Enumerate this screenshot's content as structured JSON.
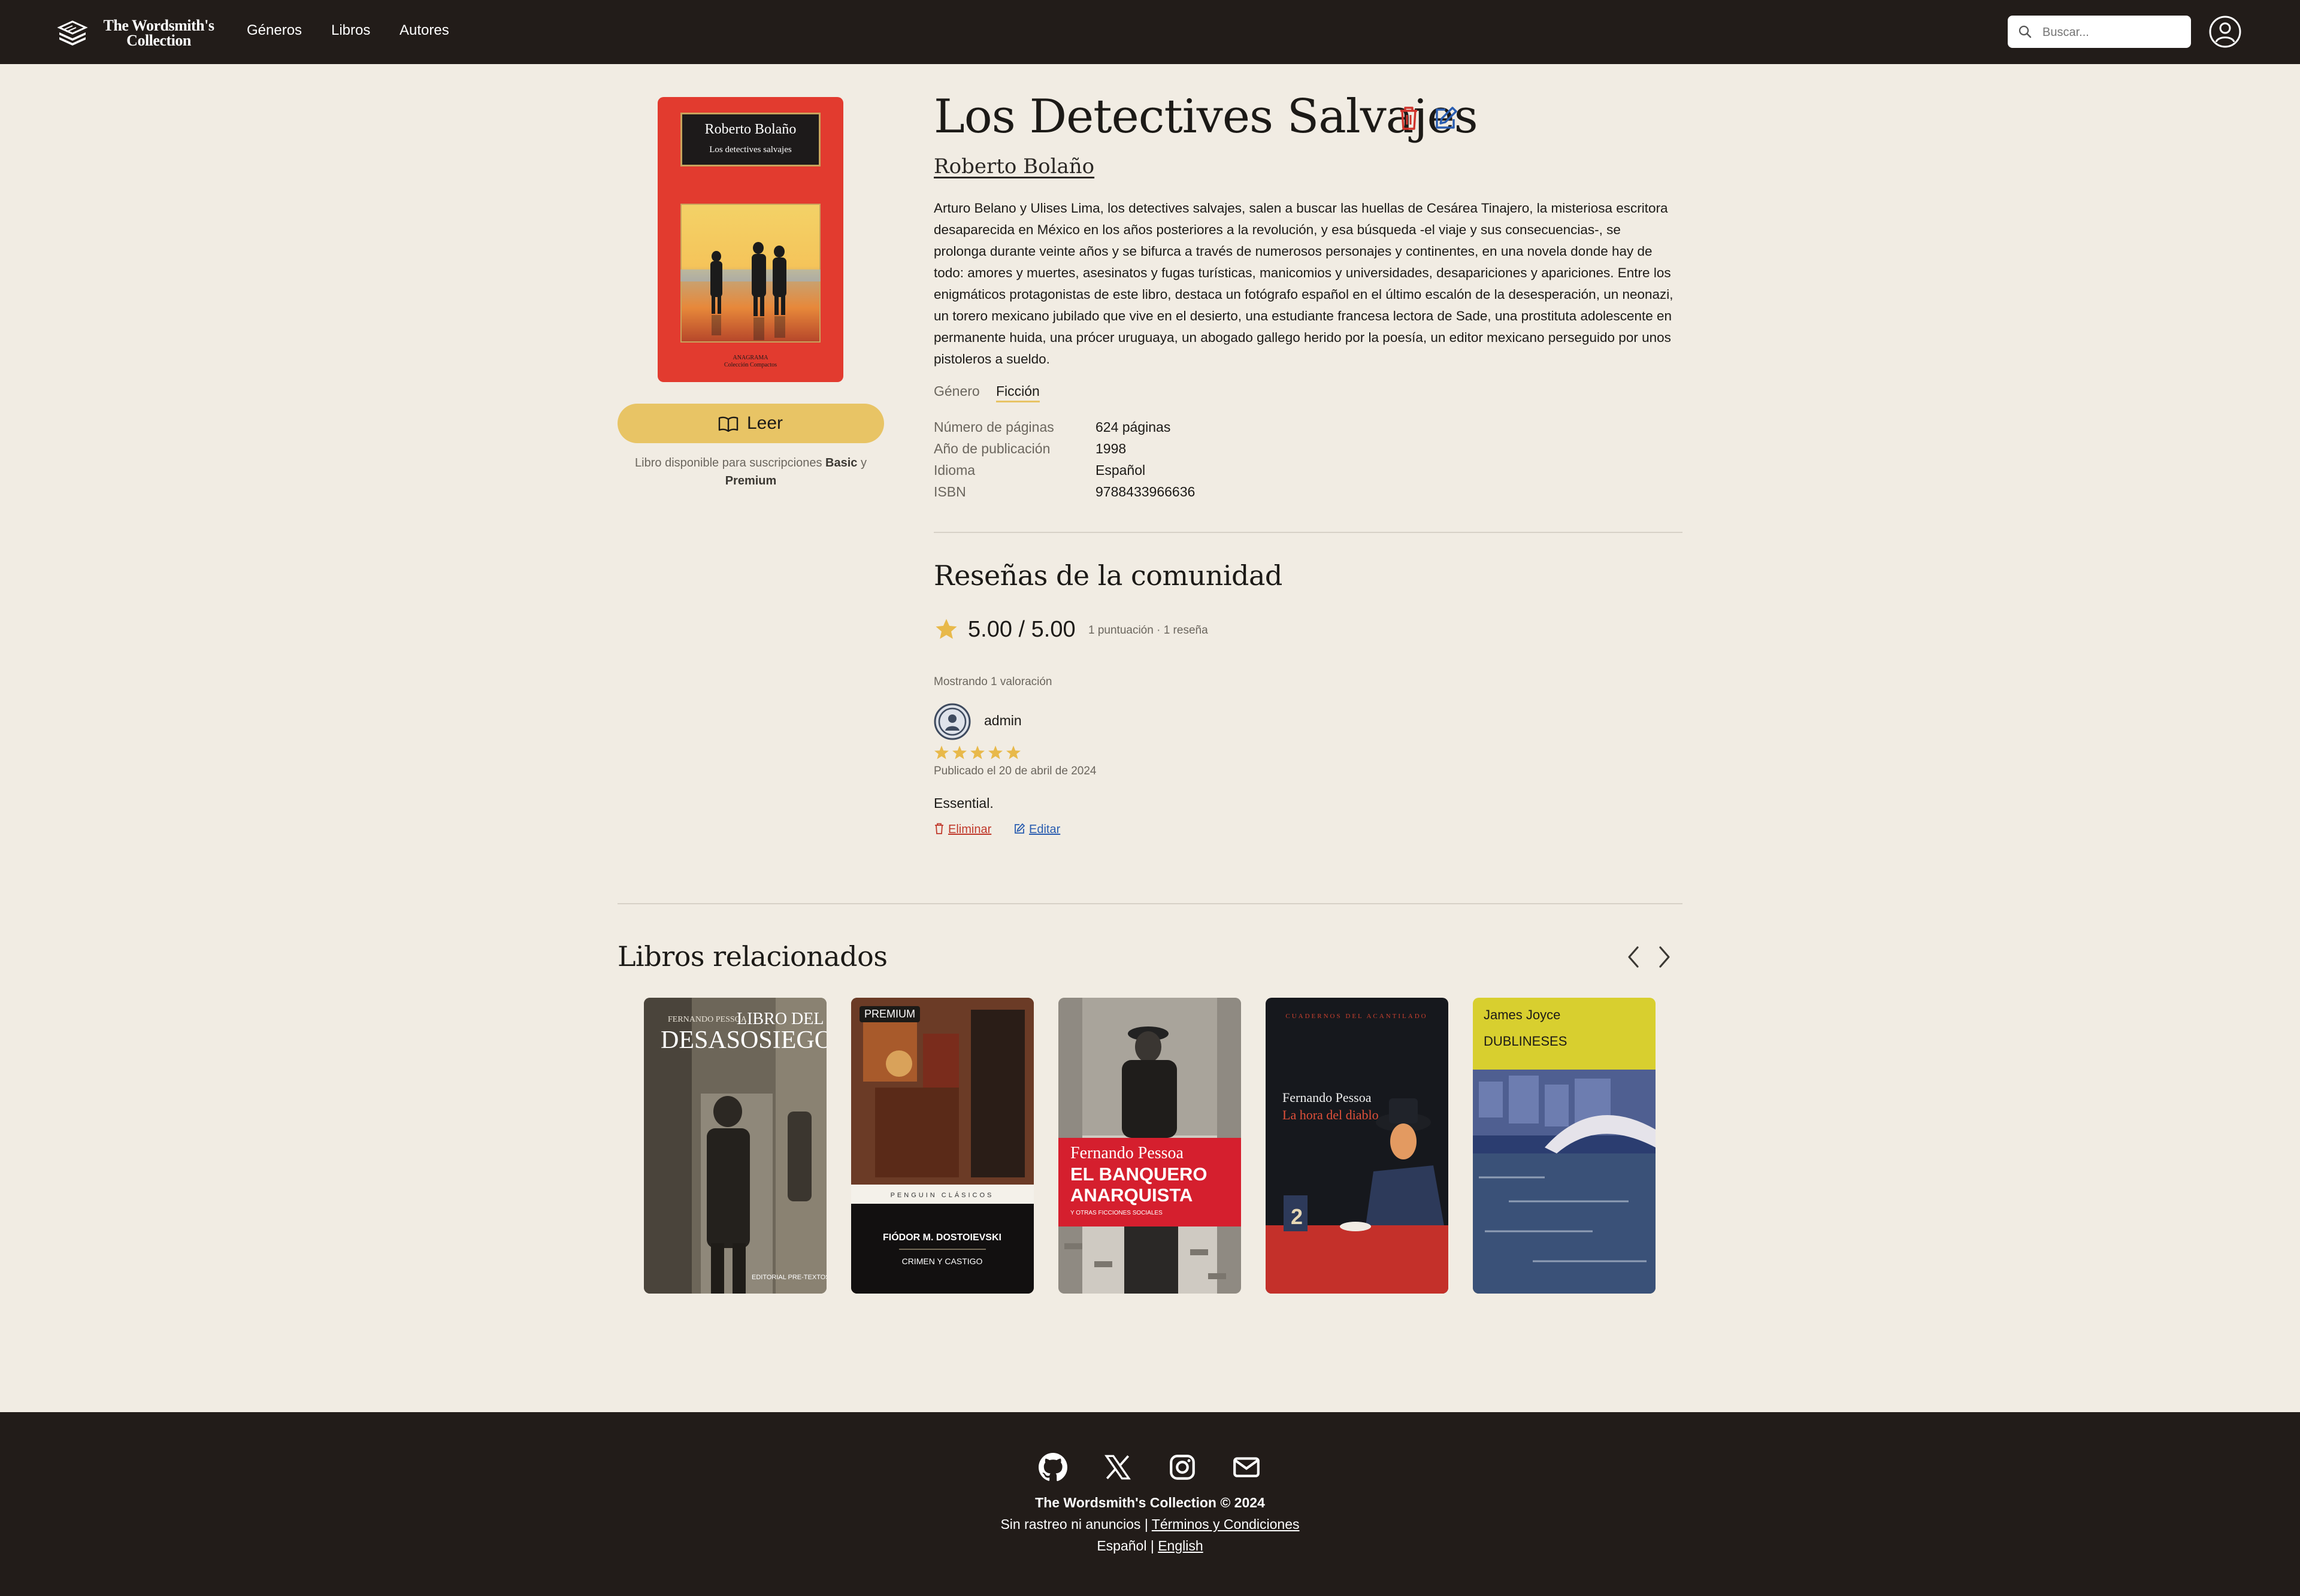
{
  "header": {
    "brand_line1": "The Wordsmith's",
    "brand_line2": "Collection",
    "nav": [
      "Géneros",
      "Libros",
      "Autores"
    ],
    "search_placeholder": "Buscar..."
  },
  "book": {
    "cover_author": "Roberto Bolaño",
    "cover_title": "Los detectives salvajes",
    "cover_publisher": "ANAGRAMA",
    "cover_collection": "Colección Compactos",
    "title": "Los Detectives Salvajes",
    "author": "Roberto Bolaño",
    "description": "Arturo Belano y Ulises Lima, los detectives salvajes, salen a buscar las huellas de Cesárea Tinajero, la misteriosa escritora desaparecida en México en los años posteriores a la revolución, y esa búsqueda -el viaje y sus consecuencias-, se prolonga durante veinte años y se bifurca a través de numerosos personajes y continentes, en una novela donde hay de todo: amores y muertes, asesinatos y fugas turísticas, manicomios y universidades, desapariciones y apariciones. Entre los enigmáticos protagonistas de este libro, destaca un fotógrafo español en el último escalón de la desesperación, un neonazi, un torero mexicano jubilado que vive en el desierto, una estudiante francesa lectora de Sade, una prostituta adolescente en permanente huida, una prócer uruguaya, un abogado gallego herido por la poesía, un editor mexicano perseguido por unos pistoleros a sueldo.",
    "genre_label": "Género",
    "genre_value": "Ficción",
    "meta": [
      {
        "label": "Número de páginas",
        "value": "624 páginas"
      },
      {
        "label": "Año de publicación",
        "value": "1998"
      },
      {
        "label": "Idioma",
        "value": "Español"
      },
      {
        "label": "ISBN",
        "value": "9788433966636"
      }
    ],
    "read_label": "Leer",
    "availability_prefix": "Libro disponible para suscripciones",
    "availability_plan1": "Basic",
    "availability_and": "y",
    "availability_plan2": "Premium"
  },
  "reviews": {
    "heading": "Reseñas de la comunidad",
    "score": "5.00 / 5.00",
    "counts": "1 puntuación · 1 reseña",
    "showing": "Mostrando 1 valoración",
    "items": [
      {
        "user": "admin",
        "rating": 5,
        "published": "Publicado el 20 de abril de 2024",
        "text": "Essential.",
        "delete_label": "Eliminar",
        "edit_label": "Editar"
      }
    ]
  },
  "related": {
    "heading": "Libros relacionados",
    "books": [
      {
        "author": "FERNANDO PESSOA",
        "title1": "LIBRO DEL",
        "title2": "DESASOSIEGO",
        "publisher": "EDITORIAL PRE-TEXTOS"
      },
      {
        "badge": "PREMIUM",
        "series": "PENGUIN CLÁSICOS",
        "author": "FIÓDOR M. DOSTOIEVSKI",
        "title": "CRIMEN Y CASTIGO"
      },
      {
        "author": "Fernando Pessoa",
        "title1": "EL BANQUERO",
        "title2": "ANARQUISTA",
        "subtitle": "Y OTRAS FICCIONES SOCIALES"
      },
      {
        "series": "CUADERNOS DEL ACANTILADO",
        "author": "Fernando Pessoa",
        "title": "La hora del diablo"
      },
      {
        "author": "James Joyce",
        "title": "DUBLINESES"
      }
    ]
  },
  "footer": {
    "line1": "The Wordsmith's Collection © 2024",
    "line2_prefix": "Sin rastreo ni anuncios |",
    "terms": "Términos y Condiciones",
    "lang_current": "Español",
    "lang_sep": "|",
    "lang_other": "English"
  },
  "colors": {
    "header_bg": "#221c19",
    "page_bg": "#f1ece3",
    "accent": "#e8c465",
    "delete": "#c0392b",
    "edit": "#2a5db0"
  }
}
